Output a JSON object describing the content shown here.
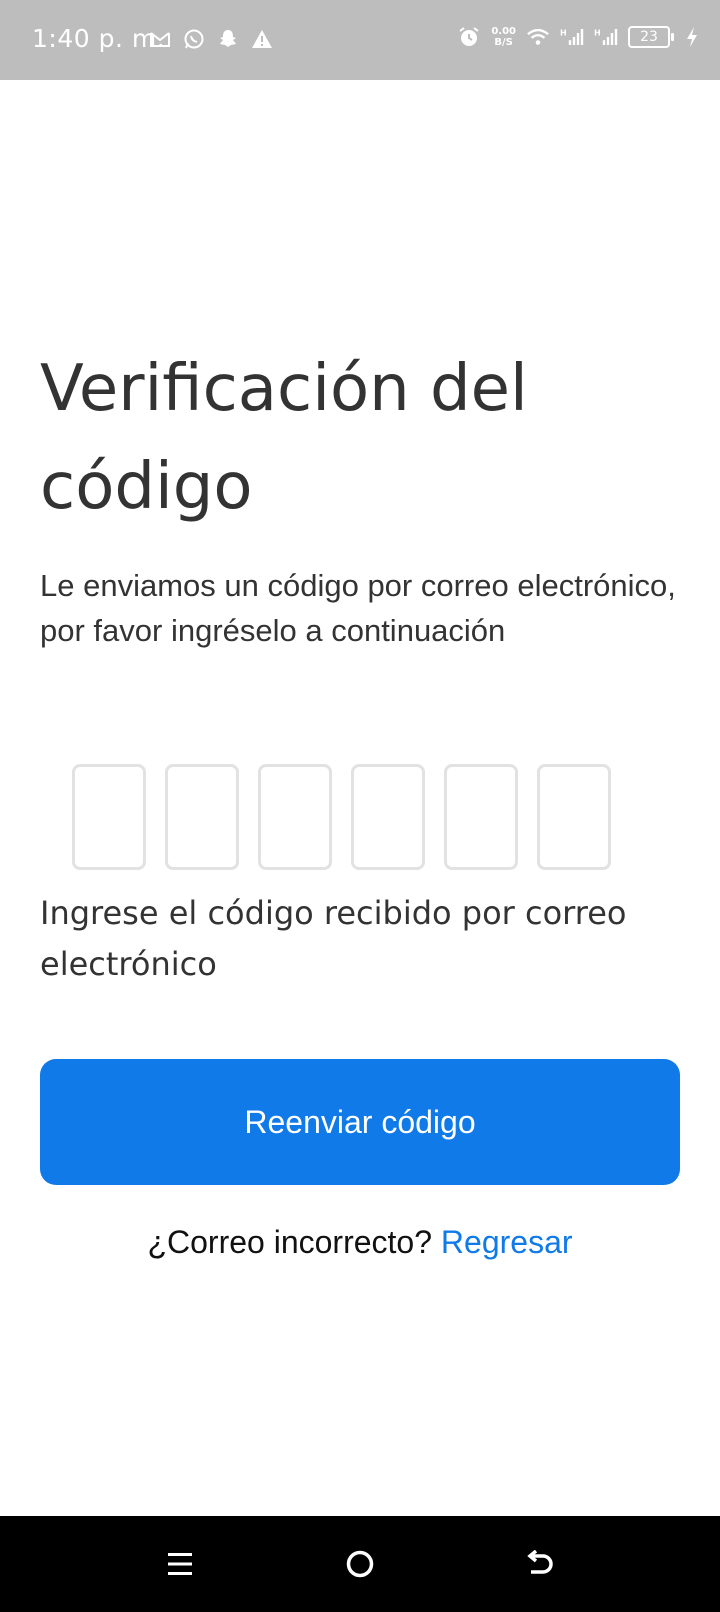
{
  "status_bar": {
    "time": "1:40 p. m.",
    "net_speed_value": "0.00",
    "net_speed_unit": "B/S",
    "battery_level": "23",
    "left_icons": [
      "gmail-icon",
      "whatsapp-icon",
      "snapchat-icon",
      "warning-icon"
    ],
    "right_icons": [
      "alarm-icon",
      "wifi-icon",
      "signal-h-icon",
      "signal-h-icon",
      "battery-icon",
      "charging-icon"
    ]
  },
  "page": {
    "title": "Verificación del código",
    "subtitle": "Le enviamos un código por correo electrónico, por favor ingréselo a continuación",
    "code_digits": [
      "",
      "",
      "",
      "",
      "",
      ""
    ],
    "hint": "Ingrese el código recibido por correo electrónico",
    "resend_button_label": "Reenviar código",
    "wrong_email_text": "¿Correo incorrecto?",
    "back_link_label": "Regresar"
  },
  "nav_bar": {
    "buttons": [
      "menu-icon",
      "home-icon",
      "back-icon"
    ]
  },
  "colors": {
    "accent": "#0f7ae8",
    "status_bar_bg": "#bdbdbd",
    "text": "#333333",
    "input_border": "#e2e2e2"
  }
}
